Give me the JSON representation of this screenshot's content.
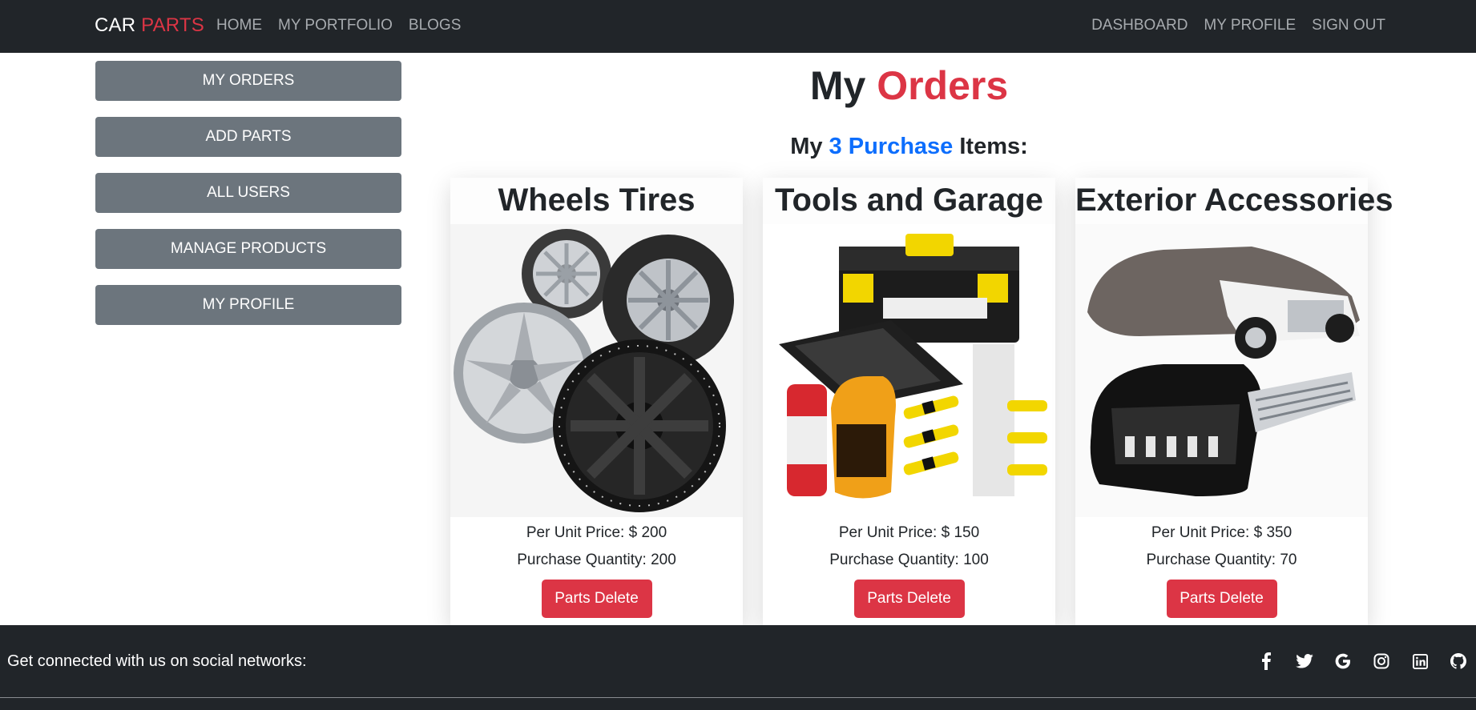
{
  "navbar": {
    "brand_first": "CAR",
    "brand_second": "PARTS",
    "left_links": [
      "HOME",
      "MY PORTFOLIO",
      "BLOGS"
    ],
    "right_links": [
      "DASHBOARD",
      "MY PROFILE",
      "SIGN OUT"
    ]
  },
  "sidebar": {
    "items": [
      "MY ORDERS",
      "ADD PARTS",
      "ALL USERS",
      "MANAGE PRODUCTS",
      "MY PROFILE"
    ]
  },
  "main": {
    "title_first": "My",
    "title_second": "Orders",
    "subtitle_prefix": "My",
    "subtitle_highlight": "3 Purchase",
    "subtitle_suffix": "Items:"
  },
  "orders": [
    {
      "name": "Wheels Tires",
      "price": "Per Unit Price: $ 200",
      "quantity": "Purchase Quantity: 200",
      "button": "Parts Delete",
      "image": "wheels-tires-image"
    },
    {
      "name": "Tools and Garage",
      "price": "Per Unit Price: $ 150",
      "quantity": "Purchase Quantity: 100",
      "button": "Parts Delete",
      "image": "tools-garage-image"
    },
    {
      "name": "Exterior Accessories",
      "price": "Per Unit Price: $ 350",
      "quantity": "Purchase Quantity: 70",
      "button": "Parts Delete",
      "image": "exterior-accessories-image"
    }
  ],
  "footer": {
    "text": "Get connected with us on social networks:",
    "socials": [
      "facebook-icon",
      "twitter-icon",
      "google-icon",
      "instagram-icon",
      "linkedin-icon",
      "github-icon"
    ]
  },
  "colors": {
    "dark": "#212529",
    "accent_red": "#dc3545",
    "accent_blue": "#0d6efd",
    "sidebar_button": "#6c757d"
  }
}
